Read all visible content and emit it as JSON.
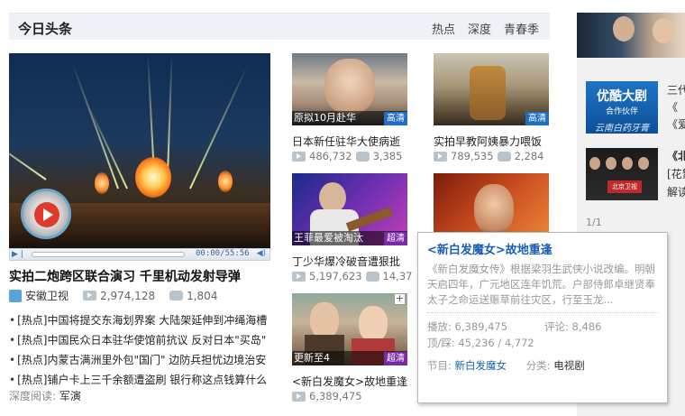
{
  "header": {
    "title": "今日头条",
    "tabs": [
      "热点",
      "深度",
      "青春季"
    ]
  },
  "main_video": {
    "time": "00:00/55:56",
    "title": "实拍二炮跨区联合演习 千里机动发射导弹",
    "source": "安徽卫视",
    "plays": "2,974,128",
    "comments": "1,804"
  },
  "news": [
    "[热点]中国将提交东海划界案 大陆架延伸到冲绳海槽",
    "[热点]中国民众日本驻华使馆前抗议 反对日本\"买岛\"",
    "[热点]内蒙古满洲里外包\"国门\" 边防兵担忧边境治安",
    "[热点]铺户卡上三千余额遭盗刷 银行称这点钱算什么"
  ],
  "depth": {
    "label": "深度阅读:",
    "value": "军演"
  },
  "thumbs": [
    {
      "caption": "原拟10月赴华",
      "badge": "高清",
      "title": "日本新任驻华大使病逝",
      "plays": "486,732",
      "comments": "3,385"
    },
    {
      "caption": "",
      "badge": "高清",
      "title": "实拍早教阿姨暴力喂饭",
      "plays": "789,535",
      "comments": "2,284"
    },
    {
      "caption": "王菲最爱被淘汰",
      "badge": "超清",
      "title": "丁少华爆冷破音遭狠批",
      "plays": "5,197,623",
      "comments": "14,37"
    },
    {
      "caption": "更新至4",
      "badge": "超清",
      "title": "<新白发魔女>故地重逢",
      "plays": "6,389,475",
      "comments": ""
    }
  ],
  "right": {
    "ad_title": "优酷大剧",
    "ad_sub": "合作伙伴",
    "ad_foot": "云南白药牙膏",
    "line1": "三代",
    "line2": "《",
    "line3": "《爱",
    "bj_line1": "《北",
    "bj_line2": "[花絮",
    "bj_line3": "解读",
    "bj_logo": "北京卫视",
    "page": "1/1"
  },
  "popup": {
    "title": "<新白发魔女>故地重逢",
    "desc": "《新白发魔女传》根据梁羽生武侠小说改编。明朝天启四年，广元地区连年饥荒。户部侍郎卓继贤奉太子之命运送赈草前往灾区，行至玉龙...",
    "plays_label": "播放: 6,389,475",
    "comments_label": "评论: 8,486",
    "updown_label": "顶/踩: 45,236 / 4,772",
    "program_label": "节目:",
    "program_value": "新白发魔女",
    "category_label": "分类:",
    "category_value": "电视剧"
  }
}
